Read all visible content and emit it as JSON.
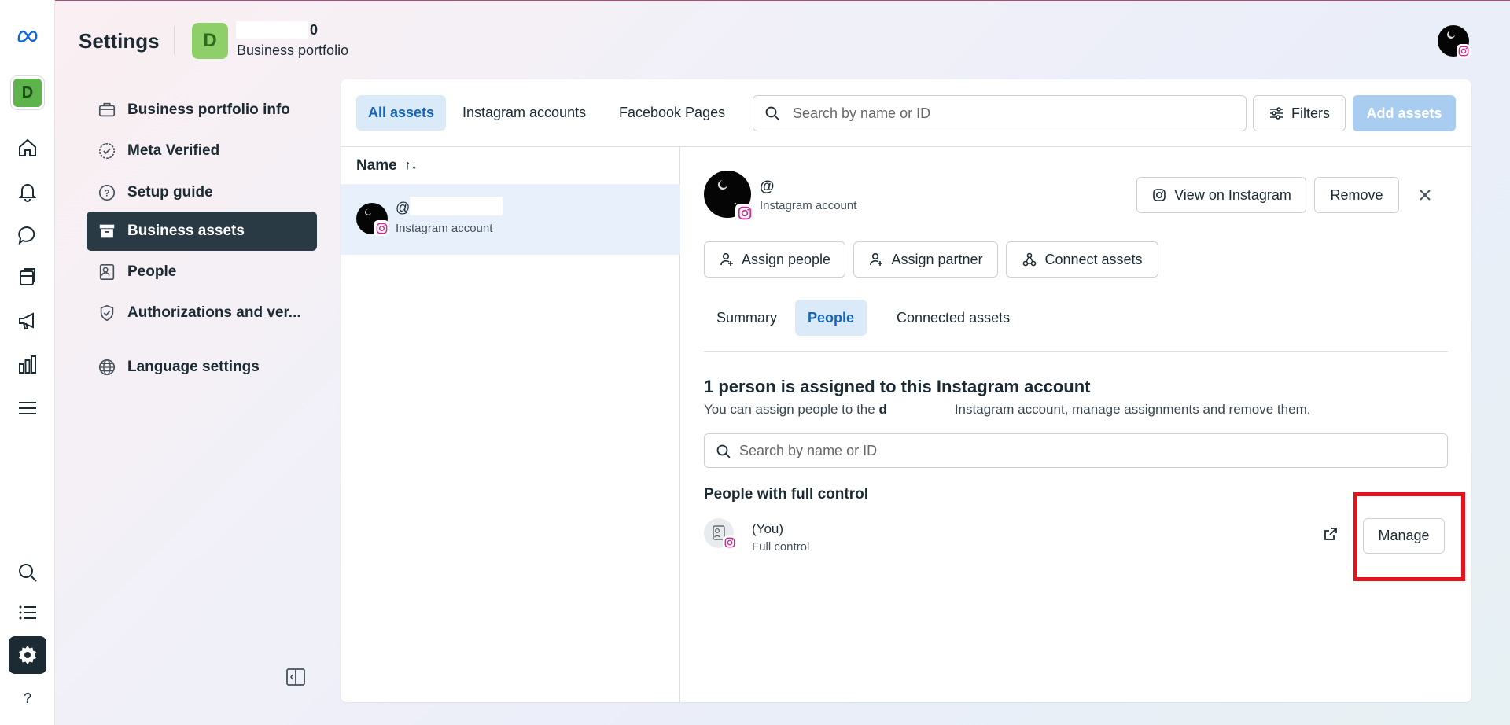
{
  "header": {
    "title": "Settings",
    "portfolio_initial": "D",
    "portfolio_name_suffix": "0",
    "portfolio_subtitle": "Business portfolio"
  },
  "rail": {
    "avatar_initial": "D",
    "items": [
      "meta-logo",
      "home-icon",
      "bell-icon",
      "chat-icon",
      "pages-icon",
      "megaphone-icon",
      "chart-icon",
      "menu-icon",
      "search-icon",
      "list-icon",
      "gear-icon",
      "help-icon"
    ]
  },
  "nav": {
    "items": [
      {
        "label": "Business portfolio info",
        "icon": "briefcase-icon"
      },
      {
        "label": "Meta Verified",
        "icon": "verified-badge-icon"
      },
      {
        "label": "Setup guide",
        "icon": "question-circle-icon"
      },
      {
        "label": "Business assets",
        "icon": "archive-box-icon",
        "active": true
      },
      {
        "label": "People",
        "icon": "id-card-icon"
      },
      {
        "label": "Authorizations and ver...",
        "icon": "shield-check-icon"
      },
      {
        "label": "Language settings",
        "icon": "globe-icon"
      }
    ]
  },
  "assets": {
    "tabs": [
      "All assets",
      "Instagram accounts",
      "Facebook Pages"
    ],
    "search_placeholder": "Search by name or ID",
    "filters_label": "Filters",
    "add_label": "Add assets",
    "list_header": "Name",
    "sort_glyph": "↑↓",
    "list_items": [
      {
        "handle": "@",
        "type": "Instagram account"
      }
    ]
  },
  "detail": {
    "handle": "@",
    "type": "Instagram account",
    "view_label": "View on Instagram",
    "remove_label": "Remove",
    "assign_people_label": "Assign people",
    "assign_partner_label": "Assign partner",
    "connect_assets_label": "Connect assets",
    "tabs": [
      "Summary",
      "People",
      "Connected assets"
    ],
    "assign_title": "1 person is assigned to this Instagram account",
    "assign_desc_pre": "You can assign people to the ",
    "assign_desc_mid": "d",
    "assign_desc_post": "Instagram account, manage assignments and remove them.",
    "search_placeholder": "Search by name or ID",
    "section_title": "People with full control",
    "person": {
      "name": "(You)",
      "role": "Full control"
    },
    "manage_label": "Manage"
  },
  "colors": {
    "accent": "#1565b8",
    "active_tab_bg": "#dbeaf8",
    "nav_active_bg": "#2a3a44",
    "add_button_bg": "#a9cdf1",
    "highlight": "#e4121c"
  }
}
